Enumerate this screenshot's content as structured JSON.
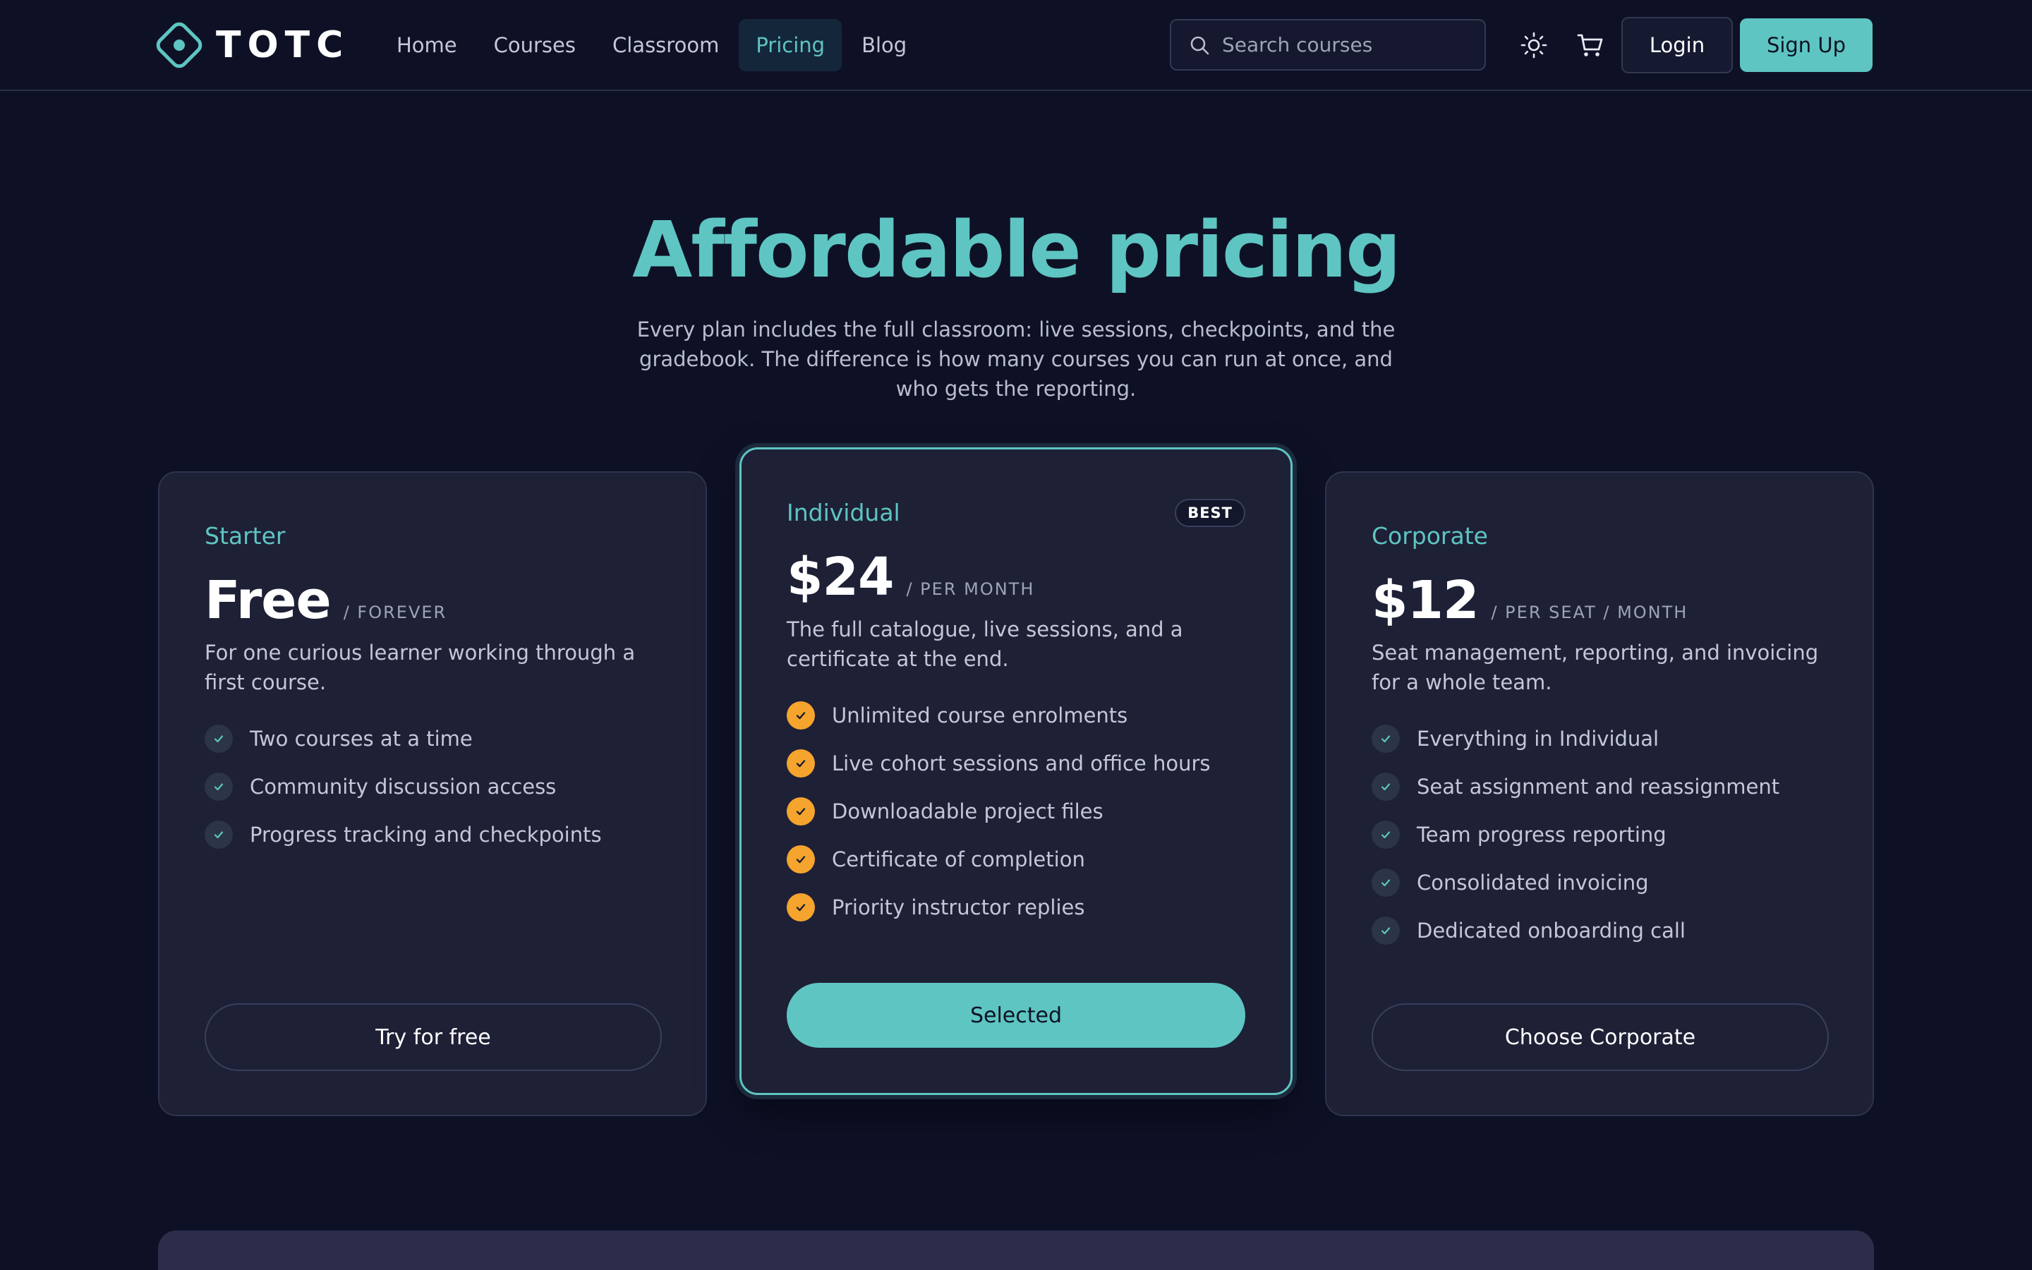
{
  "header": {
    "logo_text": "TOTC",
    "nav": [
      {
        "label": "Home",
        "active": false
      },
      {
        "label": "Courses",
        "active": false
      },
      {
        "label": "Classroom",
        "active": false
      },
      {
        "label": "Pricing",
        "active": true
      },
      {
        "label": "Blog",
        "active": false
      }
    ],
    "search": {
      "placeholder": "Search courses",
      "value": ""
    },
    "login_label": "Login",
    "signup_label": "Sign Up"
  },
  "hero": {
    "title": "Affordable pricing",
    "subtitle": "Every plan includes the full classroom: live sessions, checkpoints, and the gradebook. The difference is how many courses you can run at once, and who gets the reporting."
  },
  "plans": [
    {
      "name": "Starter",
      "price": "Free",
      "period": "/ FOREVER",
      "description": "For one curious learner working through a first course.",
      "features": [
        "Two courses at a time",
        "Community discussion access",
        "Progress tracking and checkpoints"
      ],
      "cta": "Try for free"
    },
    {
      "name": "Individual",
      "badge": "BEST",
      "price": "$24",
      "period": "/ PER MONTH",
      "description": "The full catalogue, live sessions, and a certificate at the end.",
      "features": [
        "Unlimited course enrolments",
        "Live cohort sessions and office hours",
        "Downloadable project files",
        "Certificate of completion",
        "Priority instructor replies"
      ],
      "cta": "Selected"
    },
    {
      "name": "Corporate",
      "price": "$12",
      "period": "/ PER SEAT / MONTH",
      "description": "Seat management, reporting, and invoicing for a whole team.",
      "features": [
        "Everything in Individual",
        "Seat assignment and reassignment",
        "Team progress reporting",
        "Consolidated invoicing",
        "Dedicated onboarding call"
      ],
      "cta": "Choose Corporate"
    }
  ],
  "colors": {
    "background": "#0e1126",
    "accent": "#5ec5c2",
    "check_highlight": "#f5a42e",
    "card": "#1e2036"
  },
  "icons": [
    "logo-icon",
    "search-icon",
    "sun-icon",
    "cart-icon",
    "check-icon"
  ]
}
